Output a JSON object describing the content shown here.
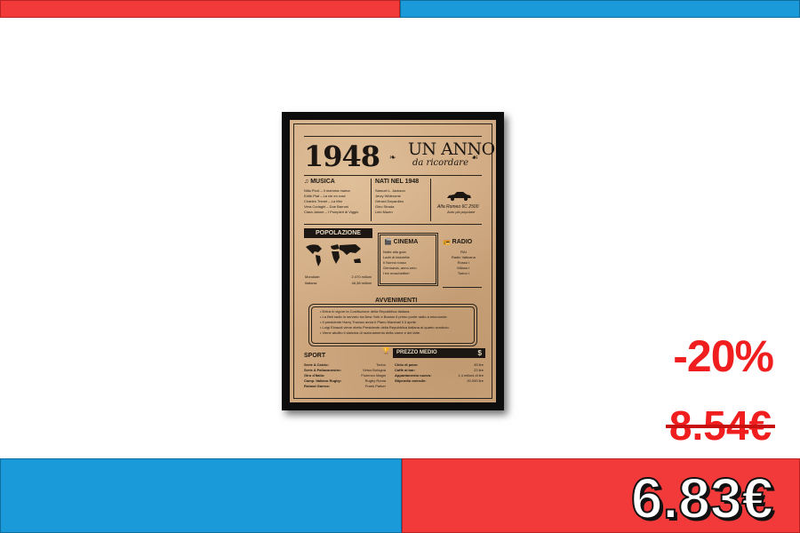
{
  "banners": {
    "top_left_color": "#f23a3a",
    "top_right_color": "#1a9ad9",
    "bottom_left_color": "#1a9ad9",
    "bottom_right_color": "#f23a3a"
  },
  "pricing": {
    "discount": "-20%",
    "old_price": "8.54€",
    "new_price": "6.83€"
  },
  "poster": {
    "year": "1948",
    "title": "UN ANNO",
    "subtitle": "da ricordare",
    "musica": {
      "heading": "MUSICA",
      "lines": [
        "Nilla Pizzi – Il mamma mama",
        "Edith Piaf – La vie en rose",
        "Charles Trenet – La Mer",
        "Vera Coriaghi – Due Barroni",
        "Clara Jaione – I Pompieri di Viggiù"
      ]
    },
    "nati": {
      "heading": "NATI NEL 1948",
      "lines": [
        "Samuel L. Jackson",
        "Jerzy Widerome",
        "Gérard Depardieu",
        "Gino Strada",
        "Lelo Mazm"
      ]
    },
    "car": {
      "name": "Alfa Romeo 6C 2500",
      "caption": "Auto più popolare"
    },
    "popolazione": {
      "heading": "POPOLAZIONE",
      "rows": [
        {
          "label": "Mondiale:",
          "value": "2.470 milioni"
        },
        {
          "label": "Italiana:",
          "value": "46,38 milioni"
        }
      ]
    },
    "cinema": {
      "heading": "CINEMA",
      "lines": [
        "Notte alla gola",
        "Ladri di biciclette",
        "Il Nonno rosso",
        "Germania, anno zero",
        "I tre moschettieri"
      ]
    },
    "radio": {
      "heading": "RADIO",
      "lines": [
        "RAI",
        "Radio Vaticana",
        "Rosso I",
        "Milano I",
        "Torino I"
      ]
    },
    "avvenimenti": {
      "heading": "AVVENIMENTI",
      "lines": [
        "Entra in vigore la Costituzione della Repubblica Italiana.",
        "La Bell radio in servizio tra New York e Boston il primo ponte radio a microonde.",
        "Il presidente Harry Truman avvia il Piano Marshall il 3 aprile.",
        "Luigi Einaudi viene eletto Presidente della Repubblica Italiana al quarto scrutinio.",
        "Viene abolito il sistema di razionamento della carne e del latte."
      ]
    },
    "sport": {
      "heading": "SPORT",
      "rows": [
        {
          "label": "Serie A Calcio:",
          "value": "Torino"
        },
        {
          "label": "Serie A Pallacanestro:",
          "value": "Virtus Bologna"
        },
        {
          "label": "Giro d'Italia:",
          "value": "Fiorenzo Magni"
        },
        {
          "label": "Camp. Italiano Rugby:",
          "value": "Rugby Roma"
        },
        {
          "label": "Roland Garros:",
          "value": "Frank Parker"
        }
      ]
    },
    "prezzo": {
      "heading": "PREZZO MEDIO",
      "symbol": "$",
      "rows": [
        {
          "label": "Chilo di pane:",
          "value": "45 lire"
        },
        {
          "label": "Caffè al bar:",
          "value": "22 lire"
        },
        {
          "label": "Appartamento nuovo:",
          "value": "1,4 milioni di lire"
        },
        {
          "label": "Stipendio mensile:",
          "value": "20.000 lire"
        }
      ]
    }
  }
}
